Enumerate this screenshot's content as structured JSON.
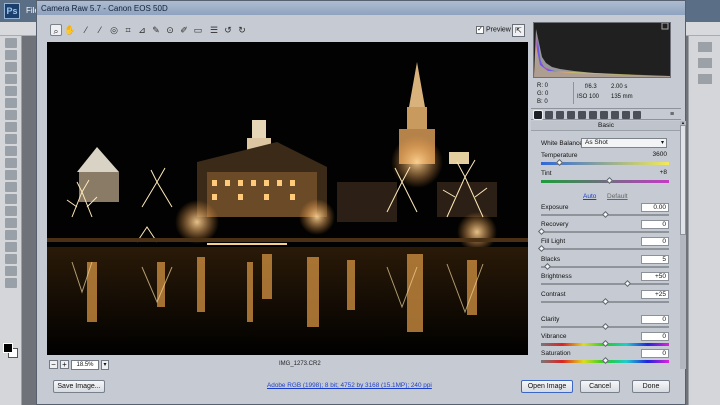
{
  "photoshop": {
    "logo": "Ps",
    "menu_file": "File"
  },
  "window": {
    "title": "Camera Raw 5.7  -  Canon EOS 50D"
  },
  "toolbar": {
    "tools": [
      "zoom-tool",
      "hand-tool",
      "white-balance-tool",
      "color-sampler-tool",
      "target-adjustment-tool",
      "crop-tool",
      "straighten-tool",
      "spot-removal-tool",
      "red-eye-tool",
      "adjustment-brush-tool",
      "graduated-filter-tool",
      "preferences-tool",
      "rotate-ccw-tool",
      "rotate-cw-tool"
    ],
    "preview_label": "Preview",
    "preview_checked": true
  },
  "image": {
    "zoom": "18.5%",
    "filename": "IMG_1273.CR2"
  },
  "camera_info": {
    "r_label": "R:",
    "r_value": "0",
    "g_label": "G:",
    "g_value": "0",
    "b_label": "B:",
    "b_value": "0",
    "aperture": "f/6.3",
    "shutter": "2.00 s",
    "iso": "ISO 100",
    "focal": "135 mm"
  },
  "panel": {
    "header": "Basic",
    "white_balance_label": "White Balance:",
    "white_balance_value": "As Shot",
    "auto_label": "Auto",
    "default_label": "Default",
    "adjustments": [
      {
        "label": "Temperature",
        "value": "3600",
        "pos": 0.14
      },
      {
        "label": "Tint",
        "value": "+8",
        "pos": 0.53
      },
      {
        "label": "Exposure",
        "value": "0.00",
        "pos": 0.5
      },
      {
        "label": "Recovery",
        "value": "0",
        "pos": 0.0
      },
      {
        "label": "Fill Light",
        "value": "0",
        "pos": 0.0
      },
      {
        "label": "Blacks",
        "value": "5",
        "pos": 0.05
      },
      {
        "label": "Brightness",
        "value": "+50",
        "pos": 0.67
      },
      {
        "label": "Contrast",
        "value": "+25",
        "pos": 0.5
      },
      {
        "label": "Clarity",
        "value": "0",
        "pos": 0.5
      },
      {
        "label": "Vibrance",
        "value": "0",
        "pos": 0.5
      },
      {
        "label": "Saturation",
        "value": "0",
        "pos": 0.5
      }
    ]
  },
  "footer": {
    "save_image": "Save Image...",
    "workflow": "Adobe RGB (1998); 8 bit; 4752 by 3168 (15.1MP); 240 ppi",
    "open_image": "Open Image",
    "cancel": "Cancel",
    "done": "Done"
  }
}
